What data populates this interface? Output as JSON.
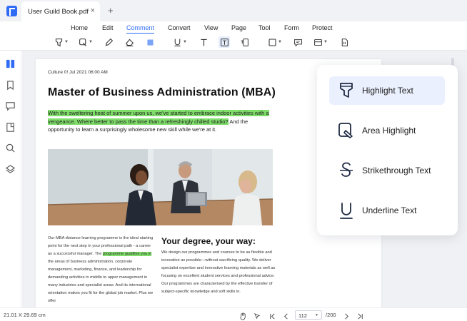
{
  "tabbar": {
    "doc_title": "User Guild Book.pdf",
    "close": "×",
    "new_tab": "+"
  },
  "menu": {
    "items": [
      "Home",
      "Edit",
      "Comment",
      "Convert",
      "View",
      "Page",
      "Tool",
      "Form",
      "Protect"
    ],
    "active": "Comment"
  },
  "toolbar": {
    "tools": [
      "highlight-icon",
      "area-highlight-icon",
      "pencil-icon",
      "eraser-icon",
      "color-square-icon",
      "underline-icon",
      "text-icon",
      "textbox-icon",
      "callout-icon",
      "rectangle-icon",
      "note-icon",
      "stamp-icon",
      "attachment-icon"
    ],
    "accent": "#2f6bf5"
  },
  "sidebar": {
    "icons": [
      "thumbnails-icon",
      "bookmark-icon",
      "comment-icon",
      "attachment-icon",
      "search-icon",
      "layers-icon"
    ]
  },
  "document": {
    "dateline": "Culture 0! Jul 2021 06:00 AM",
    "title": "Master of Business Administration (MBA)",
    "intro_highlight": "With the sweltering heat of summer upon us, we've started to embrace indoor activities with a vengeance. Where better to pass the time than a refreshingly chilled studio?",
    "intro_rest": " And the opportunity to learn a surprisingly wholesome new skill while we're at it.",
    "left_col_before": "Our MBA distance learning programme is the ideal starting point for the next step in your professional path - a career as a successful manager. The ",
    "left_col_highlight": "programme qualifies you in",
    "left_col_after": " the areas of business administration, corporate management, marketing, finance, and leadership for demanding activities in middle to upper management in many industries and specialist areas. And its international orientation makes you fit for the global job market. Plus we offer",
    "right_heading": "Your degree, your way:",
    "right_body": "We design our programmes and courses to be as flexible and innovative as possible—without sacrificing quality. We deliver specialist expertise and innovative learning materials as well as focusing on excellent student services and professional advice. Our programmes are characterised by the effective transfer of subject-specific knowledge and soft skills in."
  },
  "popup": {
    "items": [
      {
        "label": "Highlight Text",
        "icon": "highlight-text-icon",
        "active": true
      },
      {
        "label": "Area Highlight",
        "icon": "area-highlight-icon",
        "active": false
      },
      {
        "label": "Strikethrough Text",
        "icon": "strikethrough-icon",
        "active": false
      },
      {
        "label": "Underline Text",
        "icon": "underline-text-icon",
        "active": false
      }
    ]
  },
  "status": {
    "dimensions": "21.01 X 29.69 cm",
    "current_page": "112",
    "total_pages": "/200"
  },
  "colors": {
    "highlight": "#7fde6a",
    "accent": "#2f6bf5",
    "popup_active_bg": "#eaf0fd"
  }
}
